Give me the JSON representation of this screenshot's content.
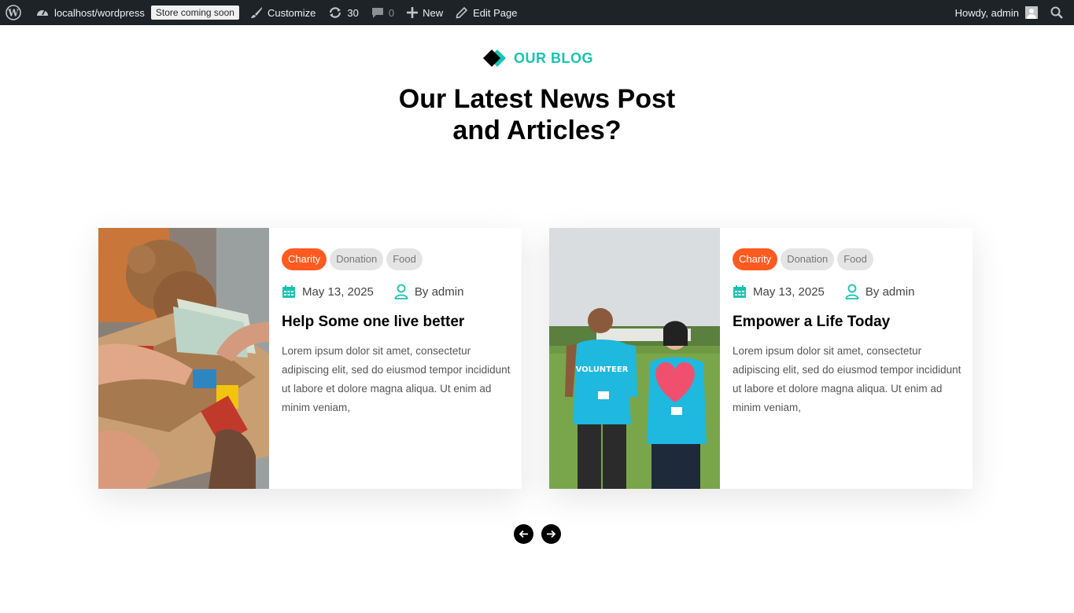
{
  "adminbar": {
    "site": "localhost/wordpress",
    "store_badge": "Store coming soon",
    "customize": "Customize",
    "updates_count": "30",
    "comments_count": "0",
    "new": "New",
    "edit_page": "Edit Page",
    "howdy": "Howdy, admin"
  },
  "section": {
    "eyebrow": "OUR BLOG",
    "heading_line1": "Our Latest News Post",
    "heading_line2": "and Articles?",
    "accent_color": "#17c3b2"
  },
  "posts": [
    {
      "tags": [
        "Charity",
        "Donation",
        "Food"
      ],
      "date": "May 13, 2025",
      "author": "By admin",
      "title": "Help Some one live better",
      "excerpt": "Lorem ipsum dolor sit amet, consectetur adipiscing elit, sed do eiusmod tempor incididunt ut labore et dolore magna aliqua. Ut enim ad minim veniam,"
    },
    {
      "tags": [
        "Charity",
        "Donation",
        "Food"
      ],
      "date": "May 13, 2025",
      "author": "By admin",
      "title": "Empower a Life Today",
      "excerpt": "Lorem ipsum dolor sit amet, consectetur adipiscing elit, sed do eiusmod tempor incididunt ut labore et dolore magna aliqua. Ut enim ad minim veniam,"
    }
  ],
  "colors": {
    "tag_active": "#ff5a1f",
    "admin_bar": "#1d2327"
  },
  "icons": [
    "wordpress-icon",
    "dashboard-icon",
    "brush-icon",
    "updates-icon",
    "comment-icon",
    "plus-icon",
    "pencil-icon",
    "search-icon",
    "calendar-icon",
    "user-icon",
    "arrow-left-icon",
    "arrow-right-icon"
  ]
}
